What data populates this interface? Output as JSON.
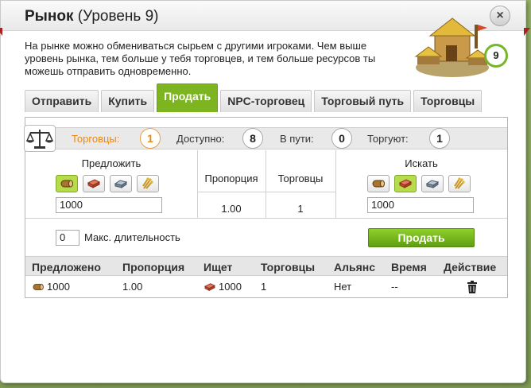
{
  "window": {
    "title_bold": "Рынок",
    "title_rest": "(Уровень 9)",
    "close_label": "×",
    "level": "9",
    "description": "На рынке можно обмениваться сырьем с другими игроками. Чем выше уровень рынка, тем больше у тебя торговцев, и тем больше ресурсов ты можешь отправить одновременно."
  },
  "tabs": [
    {
      "label": "Отправить"
    },
    {
      "label": "Купить"
    },
    {
      "label": "Продать"
    },
    {
      "label": "NPC-торговец"
    },
    {
      "label": "Торговый путь"
    },
    {
      "label": "Торговцы"
    }
  ],
  "active_tab": "Продать",
  "info": {
    "merchants_label": "Торговцы:",
    "merchants_value": "1",
    "available_label": "Доступно:",
    "available_value": "8",
    "on_way_label": "В пути:",
    "on_way_value": "0",
    "trading_label": "Торгуют:",
    "trading_value": "1"
  },
  "trade": {
    "offer_label": "Предложить",
    "offer_amount": "1000",
    "ratio_label": "Пропорция",
    "ratio_value": "1.00",
    "merchants_label": "Торговцы",
    "merchants_value": "1",
    "search_label": "Искать",
    "search_amount": "1000",
    "max_duration_value": "0",
    "max_duration_label": "Макс. длительность",
    "sell_button": "Продать",
    "resources": [
      "wood",
      "clay",
      "iron",
      "crop"
    ],
    "offer_selected": "wood",
    "search_selected": "clay"
  },
  "offers": {
    "headers": [
      "Предложено",
      "Пропорция",
      "Ищет",
      "Торговцы",
      "Альянс",
      "Время",
      "Действие"
    ],
    "rows": [
      {
        "offered": "1000",
        "offered_resource": "wood",
        "ratio": "1.00",
        "wanted": "1000",
        "wanted_resource": "clay",
        "merchants": "1",
        "alliance": "Нет",
        "time": "--"
      }
    ]
  }
}
